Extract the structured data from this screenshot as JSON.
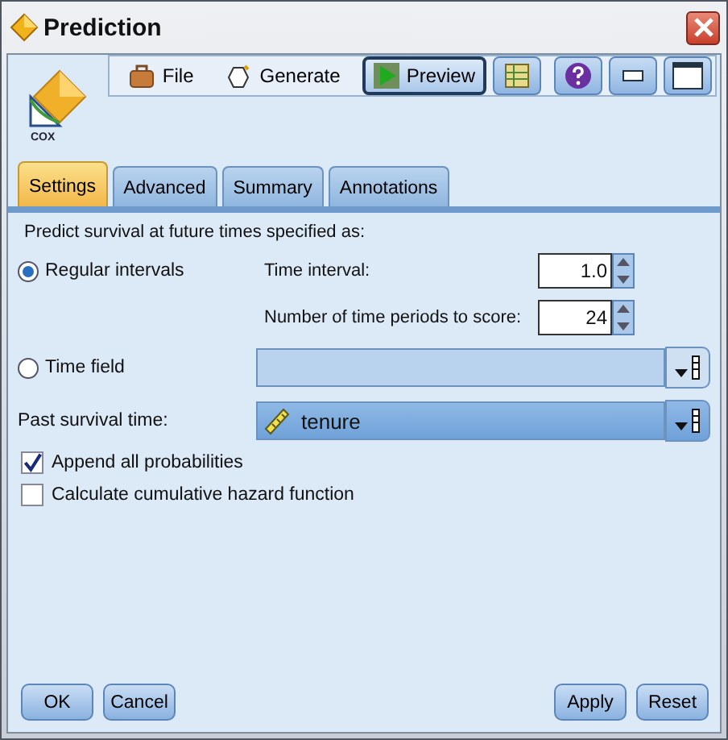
{
  "window": {
    "title": "Prediction"
  },
  "logo": {
    "label": "COX"
  },
  "toolbar": [
    {
      "kind": "menu",
      "label": "File"
    },
    {
      "kind": "menu",
      "label": "Generate"
    },
    {
      "kind": "toggle",
      "label": "Preview",
      "on": true
    },
    {
      "kind": "icon"
    }
  ],
  "tabs": [
    {
      "label": "Settings",
      "selected": true
    },
    {
      "label": "Advanced",
      "selected": false
    },
    {
      "label": "Summary",
      "selected": false
    },
    {
      "label": "Annotations",
      "selected": false
    }
  ],
  "settings": {
    "heading": "Predict survival at future times specified as:",
    "radios": [
      {
        "label": "Regular intervals",
        "selected": true
      },
      {
        "label": "Time field",
        "selected": false
      }
    ],
    "time_interval": {
      "label": "Time interval:",
      "value": "1.0"
    },
    "periods": {
      "label": "Number of time periods to score:",
      "value": "24"
    },
    "past_survival_time": {
      "label": "Past survival time:",
      "value": "tenure"
    },
    "checkboxes": [
      {
        "label": "Append all probabilities",
        "checked": true
      },
      {
        "label": "Calculate cumulative hazard function",
        "checked": false
      }
    ]
  },
  "buttons_left": [
    "OK",
    "Cancel"
  ],
  "buttons_right": [
    "Apply",
    "Reset"
  ]
}
